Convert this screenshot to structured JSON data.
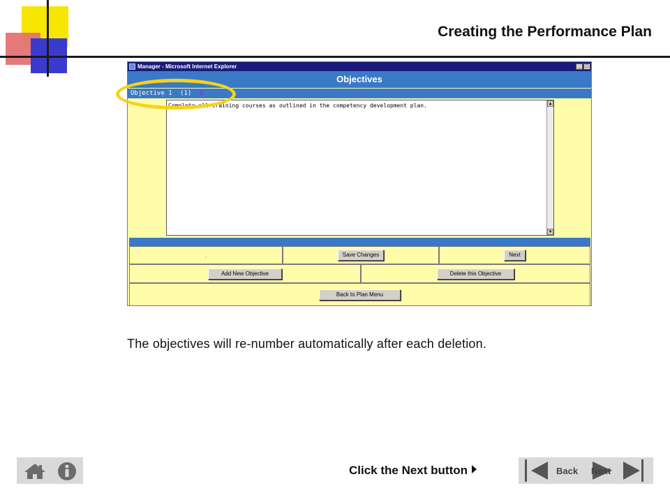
{
  "slide": {
    "title": "Creating the Performance Plan",
    "caption": "The objectives will re-number automatically after each deletion.",
    "instruction": "Click the Next button"
  },
  "browser": {
    "title": "Manager - Microsoft Internet Explorer",
    "minimize_glyph": "_",
    "maximize_glyph": "□"
  },
  "objectives_page": {
    "header": "Objectives",
    "tabs": {
      "label": "Objective 1",
      "current": "(1)",
      "other": "2"
    },
    "objective_text": "Complete all training courses as outlined in the competency development plan.",
    "placeholder_dot": ".",
    "buttons": {
      "save": "Save Changes",
      "next": "Next",
      "add": "Add New Objective",
      "delete": "Delete this Objective",
      "back_to_menu": "Back to Plan Menu"
    }
  },
  "navigation": {
    "back_label": "Back",
    "next_label": "Next"
  },
  "colors": {
    "accent_yellow": "#f7e600",
    "ie_blue": "#3a79c6",
    "form_bg": "#fffcaa",
    "highlight": "#f7d21a"
  }
}
